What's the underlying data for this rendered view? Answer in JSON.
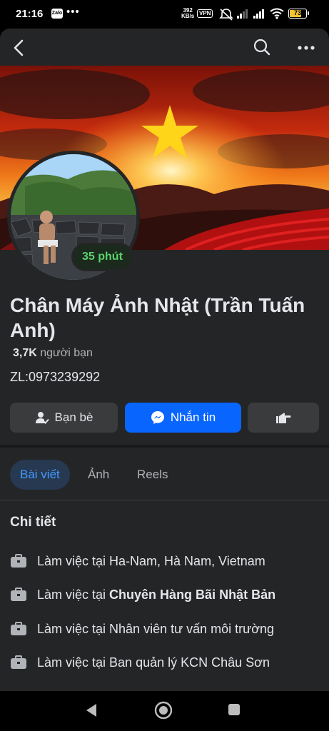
{
  "status_bar": {
    "time": "21:16",
    "notification_app": "Zalo",
    "speed_value": "392",
    "speed_unit": "KB/s",
    "vpn": "VPN",
    "battery": "73"
  },
  "profile": {
    "name": "Chân Máy Ảnh Nhật (Trần Tuấn Anh)",
    "friends_count": "3,7K",
    "friends_label": "người bạn",
    "bio": "ZL:0973239292",
    "active_badge": "35 phút"
  },
  "buttons": {
    "friends": "Bạn bè",
    "message": "Nhắn tin"
  },
  "tabs": [
    {
      "label": "Bài viết",
      "active": true
    },
    {
      "label": "Ảnh",
      "active": false
    },
    {
      "label": "Reels",
      "active": false
    }
  ],
  "details": {
    "title": "Chi tiết",
    "items": [
      {
        "prefix": "Làm việc tại Ha-Nam, Hà Nam, Vietnam",
        "bold": ""
      },
      {
        "prefix": "Làm việc tại",
        "bold": "Chuyên Hàng Bãi Nhật Bản"
      },
      {
        "prefix": "Làm việc tại Nhân viên tư vấn môi trường",
        "bold": ""
      },
      {
        "prefix": "Làm việc tại Ban quản lý KCN Châu Sơn",
        "bold": ""
      }
    ]
  },
  "icons": {
    "back": "back-arrow-icon",
    "search": "search-icon",
    "more": "more-icon",
    "work": "briefcase-icon"
  },
  "colors": {
    "background": "#242526",
    "primary_button": "#0866ff",
    "active_tab_text": "#4599ff",
    "badge_text": "#5ad26e"
  }
}
